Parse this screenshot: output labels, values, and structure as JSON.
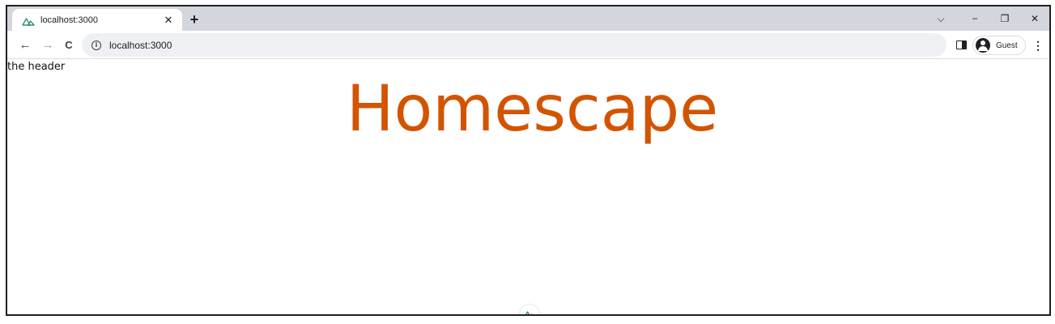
{
  "browser": {
    "tab": {
      "title": "localhost:3000",
      "favicon": "nuxt-icon",
      "close_icon": "close-icon",
      "close_glyph": "✕"
    },
    "new_tab_glyph": "+",
    "window_controls": {
      "tab_search_glyph": "⌵",
      "minimize_glyph": "−",
      "restore_glyph": "❐",
      "close_glyph": "✕"
    },
    "toolbar": {
      "back_glyph": "←",
      "forward_glyph": "→",
      "reload_glyph": "C",
      "site_info_glyph": "i",
      "url": "localhost:3000",
      "profile_label": "Guest",
      "menu_glyph": "⋮"
    }
  },
  "page": {
    "header_text": "the header",
    "title": "Homescape",
    "title_color": "#d35400",
    "devtools_icon": "nuxt-devtools-icon"
  }
}
